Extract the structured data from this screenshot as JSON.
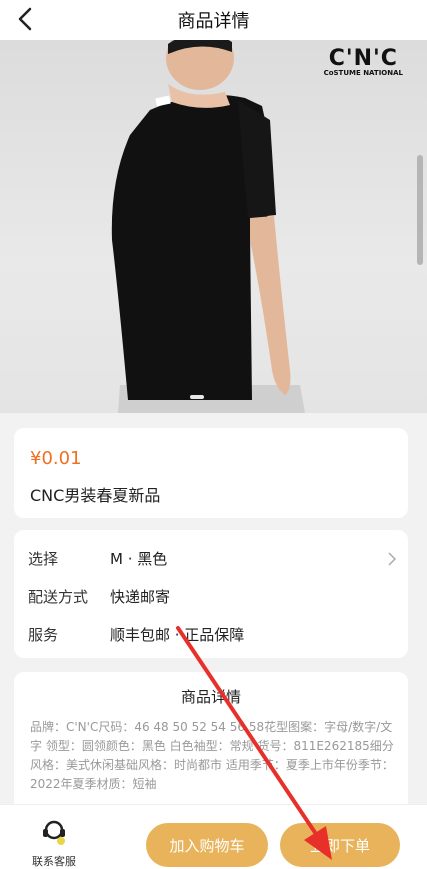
{
  "header": {
    "title": "商品详情",
    "back_icon": "chevron-left-icon"
  },
  "hero": {
    "brand_main": "C'N'C",
    "brand_sub": "CoSTUME NATIONAL"
  },
  "product": {
    "price": "¥0.01",
    "name": "CNC男装春夏新品"
  },
  "options": [
    {
      "key": "选择",
      "value": "M · 黑色"
    },
    {
      "key": "配送方式",
      "value": "快递邮寄"
    },
    {
      "key": "服务",
      "value": "顺丰包邮 · 正品保障"
    }
  ],
  "detail": {
    "title": "商品详情",
    "lines": "品牌：C'N'C尺码：46 48 50 52 54 56 58花型图案：字母/数字/文字 领型：圆领颜色：黑色 白色袖型：常规 货号：811E262185细分风格：美式休闲基础风格：时尚都市 适用季节：夏季上市年份季节：2022年夏季材质：短袖"
  },
  "bottom": {
    "service_label": "联系客服",
    "cart_label": "加入购物车",
    "buy_label": "立即下单"
  },
  "colors": {
    "accent": "#e8b35a",
    "price": "#f07020",
    "annotation": "#e8302a"
  }
}
